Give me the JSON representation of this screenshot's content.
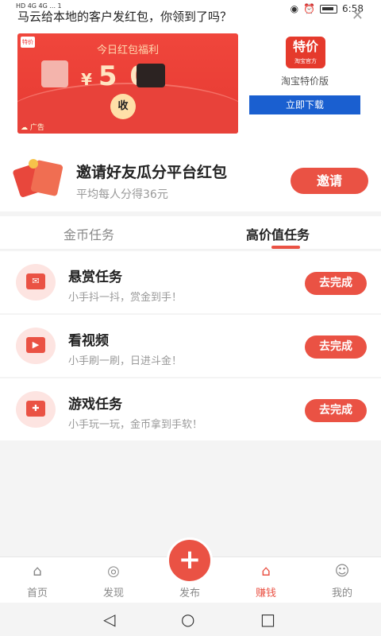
{
  "status": {
    "left": "HD 4G 4G ... 1",
    "time": "6:58"
  },
  "ad": {
    "title": "马云给本地的客户发红包，你领到了吗？",
    "banner_sub": "今日红包福利",
    "amount_yen": "¥",
    "amount": "5  0",
    "collect": "收",
    "mini_logo": "特价",
    "tag": "广告",
    "app_logo_big": "特价",
    "app_logo_small": "淘宝官方",
    "app_name": "淘宝特价版",
    "download": "立即下载"
  },
  "invite": {
    "title": "邀请好友瓜分平台红包",
    "subtitle": "平均每人分得36元",
    "button": "邀请"
  },
  "tabs": [
    {
      "label": "金币任务",
      "active": false
    },
    {
      "label": "高价值任务",
      "active": true
    }
  ],
  "tasks": [
    {
      "title": "悬赏任务",
      "subtitle": "小手抖一抖，赏金到手！",
      "button": "去完成",
      "icon": "reward-icon"
    },
    {
      "title": "看视频",
      "subtitle": "小手刷一刷，日进斗金！",
      "button": "去完成",
      "icon": "video-icon"
    },
    {
      "title": "游戏任务",
      "subtitle": "小手玩一玩，金币拿到手软！",
      "button": "去完成",
      "icon": "gamepad-icon"
    }
  ],
  "nav": [
    {
      "label": "首页",
      "icon": "home-icon"
    },
    {
      "label": "发现",
      "icon": "discover-icon"
    },
    {
      "label": "发布",
      "icon": "plus-icon"
    },
    {
      "label": "赚钱",
      "icon": "earn-icon",
      "active": true
    },
    {
      "label": "我的",
      "icon": "profile-icon"
    }
  ],
  "publish_symbol": "+",
  "colors": {
    "accent": "#ea5244",
    "download_blue": "#1a5fd0"
  }
}
